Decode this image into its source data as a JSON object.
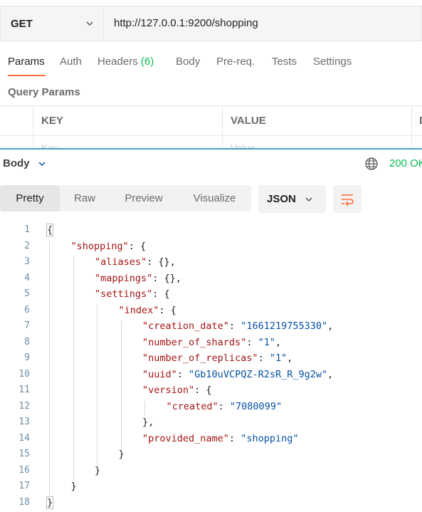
{
  "request": {
    "method": "GET",
    "url": "http://127.0.0.1:9200/shopping"
  },
  "tabs": {
    "params": "Params",
    "auth": "Auth",
    "headers": "Headers",
    "headers_count": "(6)",
    "body": "Body",
    "prereq": "Pre-req.",
    "tests": "Tests",
    "settings": "Settings"
  },
  "query_params": {
    "title": "Query Params",
    "columns": {
      "key": "KEY",
      "value": "VALUE",
      "desc": "D"
    },
    "placeholder_row": {
      "key": "Key",
      "value": "Value"
    }
  },
  "response": {
    "body_label": "Body",
    "status": "200 OK",
    "views": [
      "Pretty",
      "Raw",
      "Preview",
      "Visualize"
    ],
    "format": "JSON"
  },
  "colors": {
    "accent": "#ff6c37",
    "status_green": "#0cbb52",
    "key_color": "#a31515",
    "string_color": "#0451a5",
    "divider_blue": "#4f9cd6"
  },
  "icons": [
    "chevron-down-icon",
    "globe-icon",
    "wrap-lines-icon"
  ],
  "code_lines": [
    {
      "n": "1",
      "indent": 0,
      "parts": [
        {
          "t": "p",
          "v": "{"
        }
      ]
    },
    {
      "n": "2",
      "indent": 1,
      "parts": [
        {
          "t": "k",
          "v": "\"shopping\""
        },
        {
          "t": "p",
          "v": ": {"
        }
      ]
    },
    {
      "n": "3",
      "indent": 2,
      "parts": [
        {
          "t": "k",
          "v": "\"aliases\""
        },
        {
          "t": "p",
          "v": ": {},"
        }
      ]
    },
    {
      "n": "4",
      "indent": 2,
      "parts": [
        {
          "t": "k",
          "v": "\"mappings\""
        },
        {
          "t": "p",
          "v": ": {},"
        }
      ]
    },
    {
      "n": "5",
      "indent": 2,
      "parts": [
        {
          "t": "k",
          "v": "\"settings\""
        },
        {
          "t": "p",
          "v": ": {"
        }
      ]
    },
    {
      "n": "6",
      "indent": 3,
      "parts": [
        {
          "t": "k",
          "v": "\"index\""
        },
        {
          "t": "p",
          "v": ": {"
        }
      ]
    },
    {
      "n": "7",
      "indent": 4,
      "parts": [
        {
          "t": "k",
          "v": "\"creation_date\""
        },
        {
          "t": "p",
          "v": ": "
        },
        {
          "t": "s",
          "v": "\"1661219755330\""
        },
        {
          "t": "p",
          "v": ","
        }
      ]
    },
    {
      "n": "8",
      "indent": 4,
      "parts": [
        {
          "t": "k",
          "v": "\"number_of_shards\""
        },
        {
          "t": "p",
          "v": ": "
        },
        {
          "t": "s",
          "v": "\"1\""
        },
        {
          "t": "p",
          "v": ","
        }
      ]
    },
    {
      "n": "9",
      "indent": 4,
      "parts": [
        {
          "t": "k",
          "v": "\"number_of_replicas\""
        },
        {
          "t": "p",
          "v": ": "
        },
        {
          "t": "s",
          "v": "\"1\""
        },
        {
          "t": "p",
          "v": ","
        }
      ]
    },
    {
      "n": "10",
      "indent": 4,
      "parts": [
        {
          "t": "k",
          "v": "\"uuid\""
        },
        {
          "t": "p",
          "v": ": "
        },
        {
          "t": "s",
          "v": "\"Gb10uVCPQZ-R2sR_R_9g2w\""
        },
        {
          "t": "p",
          "v": ","
        }
      ]
    },
    {
      "n": "11",
      "indent": 4,
      "parts": [
        {
          "t": "k",
          "v": "\"version\""
        },
        {
          "t": "p",
          "v": ": {"
        }
      ]
    },
    {
      "n": "12",
      "indent": 5,
      "parts": [
        {
          "t": "k",
          "v": "\"created\""
        },
        {
          "t": "p",
          "v": ": "
        },
        {
          "t": "s",
          "v": "\"7080099\""
        }
      ]
    },
    {
      "n": "13",
      "indent": 4,
      "parts": [
        {
          "t": "p",
          "v": "},"
        }
      ]
    },
    {
      "n": "14",
      "indent": 4,
      "parts": [
        {
          "t": "k",
          "v": "\"provided_name\""
        },
        {
          "t": "p",
          "v": ": "
        },
        {
          "t": "s",
          "v": "\"shopping\""
        }
      ]
    },
    {
      "n": "15",
      "indent": 3,
      "parts": [
        {
          "t": "p",
          "v": "}"
        }
      ]
    },
    {
      "n": "16",
      "indent": 2,
      "parts": [
        {
          "t": "p",
          "v": "}"
        }
      ]
    },
    {
      "n": "17",
      "indent": 1,
      "parts": [
        {
          "t": "p",
          "v": "}"
        }
      ]
    },
    {
      "n": "18",
      "indent": 0,
      "parts": [
        {
          "t": "p",
          "v": "}"
        }
      ]
    }
  ]
}
